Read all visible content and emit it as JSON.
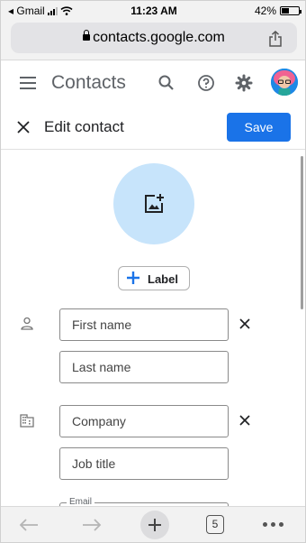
{
  "status_bar": {
    "carrier": "◂ Gmail",
    "time": "11:23 AM",
    "battery_percent": "42%",
    "battery_level": 0.42,
    "signal_bars": 3
  },
  "browser": {
    "url": "contacts.google.com",
    "share_icon": "share-icon",
    "open_tabs": "5"
  },
  "app_header": {
    "title": "Contacts",
    "icons": [
      "menu-icon",
      "search-icon",
      "help-icon",
      "settings-icon",
      "avatar"
    ]
  },
  "edit_bar": {
    "title": "Edit contact",
    "save_label": "Save"
  },
  "form": {
    "photo_icon": "add-photo-icon",
    "label_button": "Label",
    "first_name_placeholder": "First name",
    "last_name_placeholder": "Last name",
    "company_placeholder": "Company",
    "job_title_placeholder": "Job title",
    "email_label": "Email"
  },
  "colors": {
    "accent": "#1a73e8",
    "photo_circle": "#c7e4fb"
  }
}
